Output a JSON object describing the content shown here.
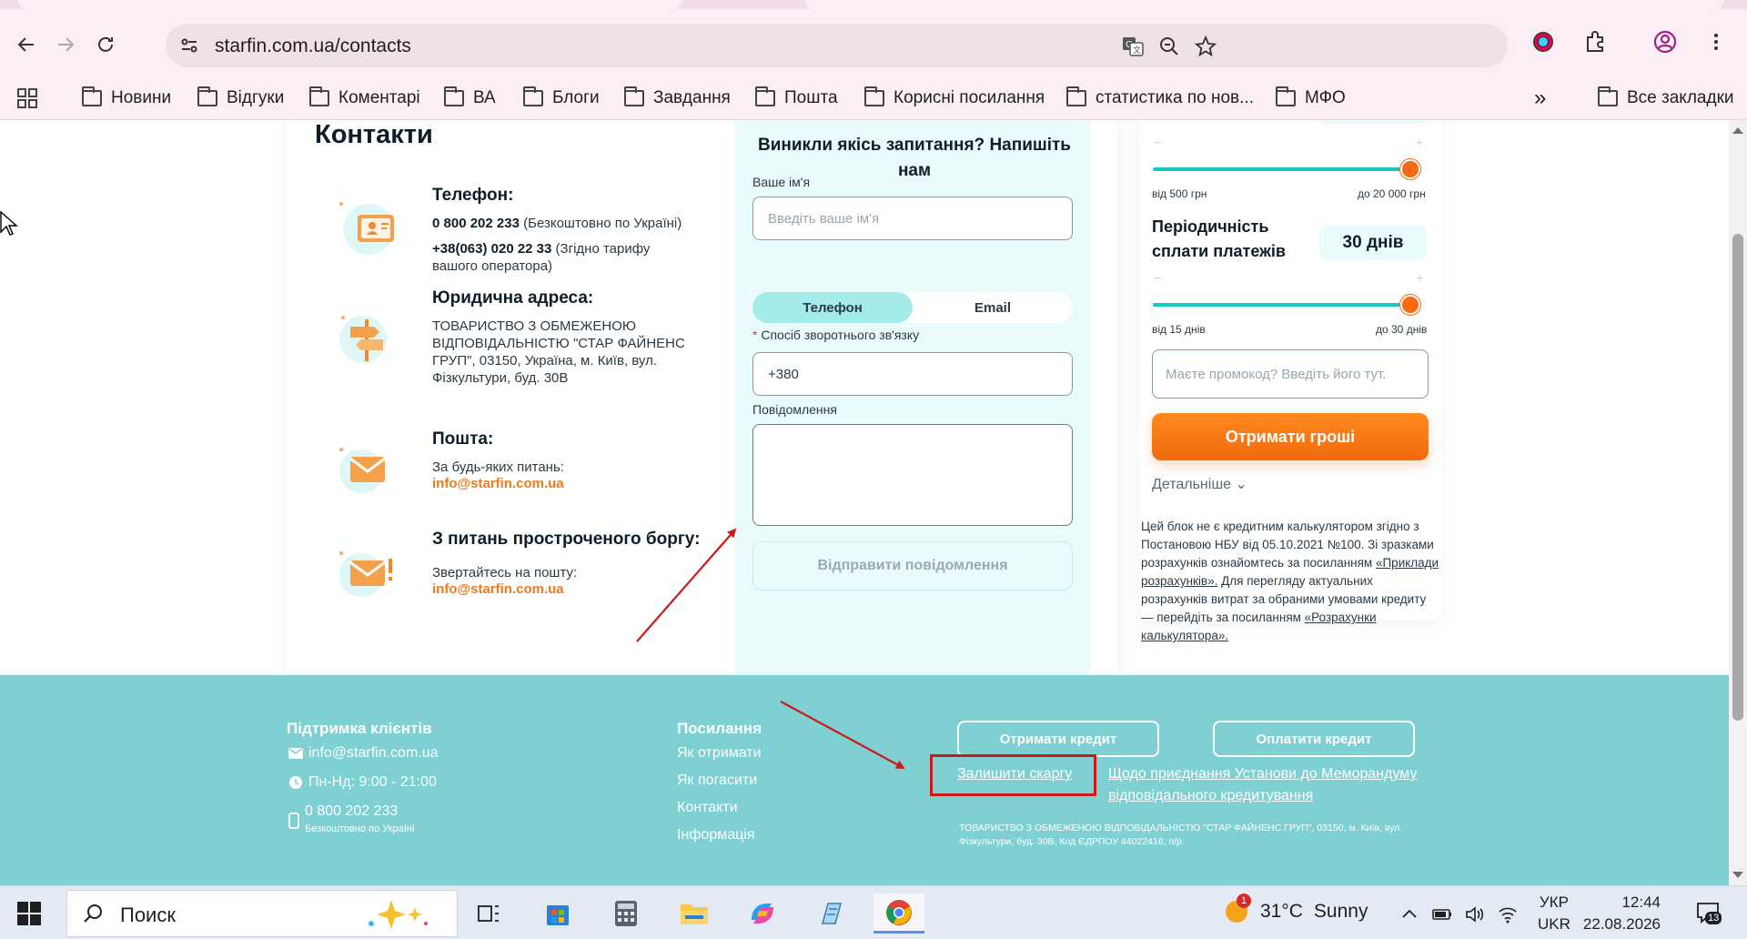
{
  "browser": {
    "url": "starfin.com.ua/contacts",
    "bookmarks": [
      "Новини",
      "Відгуки",
      "Коментарі",
      "ВА",
      "Блоги",
      "Завдання",
      "Пошта",
      "Корисні посилання",
      "статистика по нов...",
      "МФО"
    ],
    "all_bookmarks": "Все закладки",
    "overflow": "»"
  },
  "contacts": {
    "title": "Контакти",
    "phone": {
      "heading": "Телефон:",
      "number1": "0 800 202 233",
      "note1": "(Безкоштовно по Україні)",
      "number2": "+38(063) 020 22 33",
      "note2": "(Згідно тарифу вашого оператора)"
    },
    "address": {
      "heading": "Юридична адреса:",
      "text": "ТОВАРИСТВО З ОБМЕЖЕНОЮ ВІДПОВІДАЛЬНІСТЮ \"СТАР ФАЙНЕНС ГРУП\", 03150, Україна, м. Київ, вул. Фізкультури, буд. 30В"
    },
    "mail": {
      "heading": "Пошта:",
      "text": "За будь-яких питань:",
      "email": "info@starfin.com.ua"
    },
    "debt": {
      "heading": "З питань простроченого боргу:",
      "text": "Звертайтесь на пошту:",
      "email": "info@starfin.com.ua"
    }
  },
  "form": {
    "title": "Виникли якісь запитання? Напишіть нам",
    "name_label": "Ваше ім'я",
    "name_placeholder": "Введіть ваше ім'я",
    "toggle_phone": "Телефон",
    "toggle_email": "Email",
    "feedback_required": "*",
    "feedback_label": "Спосіб зворотнього зв'язку",
    "phone_value": "+380",
    "message_label": "Повідомлення",
    "message_value": "",
    "send": "Відправити повідомлення"
  },
  "calculator": {
    "amount_min": "від 500 грн",
    "amount_max": "до 20 000 грн",
    "amount_level": 1.0,
    "period_label": "Періодичність сплати платежів",
    "period_value": "30 днів",
    "period_min": "від 15 днів",
    "period_max": "до 30 днів",
    "period_level": 1.0,
    "minus": "−",
    "plus": "+",
    "promo_placeholder": "Маєте промокод? Введіть його тут.",
    "cta": "Отримати гроші",
    "details": "Детальніше ⌄",
    "disclaimer_1": "Цей блок не є кредитним калькулятором згідно з Постановою НБУ від 05.10.2021 №100. Зі зразками розрахунків ознайомтесь за посиланням ",
    "disclaimer_link1": "«Приклади розрахунків».",
    "disclaimer_2": " Для перегляду актуальних розрахунків витрат за обраними умовами кредиту — перейдіть за посиланням ",
    "disclaimer_link2": "«Розрахунки калькулятора»."
  },
  "footer": {
    "support_heading": "Підтримка клієнтів",
    "email": "info@starfin.com.ua",
    "hours": "Пн-Нд: 9:00 - 21:00",
    "phone": "0 800 202 233",
    "phone_note": "Безкоштовно по Україні",
    "links_heading": "Посилання",
    "links": [
      "Як отримати",
      "Як погасити",
      "Контакти",
      "Інформація"
    ],
    "btn_get_credit": "Отримати кредит",
    "btn_pay_credit": "Оплатити кредит",
    "complaint": "Залишити скаргу",
    "memorandum": "Щодо приєднання Установи до Меморандуму відповідального кредитування",
    "legal": "ТОВАРИСТВО З ОБМЕЖЕНОЮ ВІДПОВІДАЛЬНІСТЮ \"СТАР ФАЙНЕНС ГРУП\", 03150, м. Київ, вул. Фізкультури, буд. 30В, Код ЄДРПОУ 44022416, п/р"
  },
  "taskbar": {
    "search": "Поиск",
    "weather_temp": "31°C",
    "weather_text": "Sunny",
    "weather_badge": "1",
    "lang1": "УКР",
    "lang2": "UKR",
    "time": "12:44",
    "date": "22.08.2026",
    "notifications": "13"
  },
  "colors": {
    "accent_orange": "#f26a0e",
    "accent_teal": "#18c6c6",
    "footer_bg": "#7ed0d3",
    "annotation_red": "#cc1a1a"
  }
}
